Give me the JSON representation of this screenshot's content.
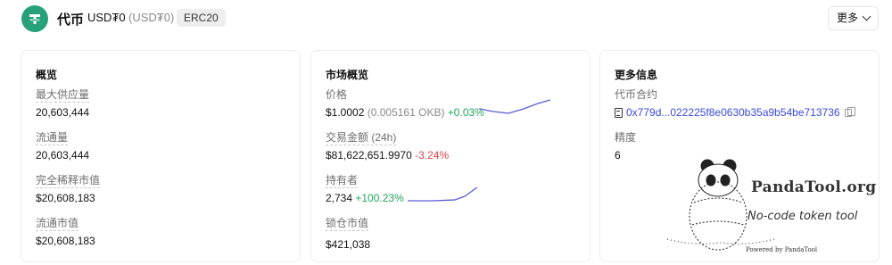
{
  "header": {
    "token_name": "代币",
    "symbol": "USD₮0",
    "symbol_alt": "(USD₮0)",
    "chain_badge": "ERC20",
    "more_label": "更多"
  },
  "overview": {
    "title": "概览",
    "fields": [
      {
        "label": "最大供应量",
        "value": "20,603,444"
      },
      {
        "label": "流通量",
        "value": "20,603,444"
      },
      {
        "label": "完全稀释市值",
        "value": "$20,608,183"
      },
      {
        "label": "流通市值",
        "value": "$20,608,183"
      }
    ]
  },
  "market": {
    "title": "市场概览",
    "price": {
      "label": "价格",
      "value": "$1.0002",
      "sub": "(0.005161 OKB)",
      "change": "+0.03%"
    },
    "volume": {
      "label": "交易金额 (24h)",
      "value": "$81,622,651.9970",
      "change": "-3.24%"
    },
    "holders": {
      "label": "持有者",
      "value": "2,734",
      "change": "+100.23%"
    },
    "locked": {
      "label": "锁仓市值",
      "value": "$421,038"
    }
  },
  "more_info": {
    "title": "更多信息",
    "contract_label": "代币合约",
    "contract_value": "0x779d...022225f8e0630b35a9b54be713736",
    "precision_label": "精度",
    "precision_value": "6"
  },
  "watermark": {
    "brand": "PandaTool.org",
    "slogan": "No-code token tool",
    "powered": "Powered by PandaTool"
  },
  "colors": {
    "brand_green": "#26a17b",
    "up": "#1fa75a",
    "down": "#e0424a",
    "link": "#3a4bd9",
    "sparkline": "#5b5bd6"
  }
}
